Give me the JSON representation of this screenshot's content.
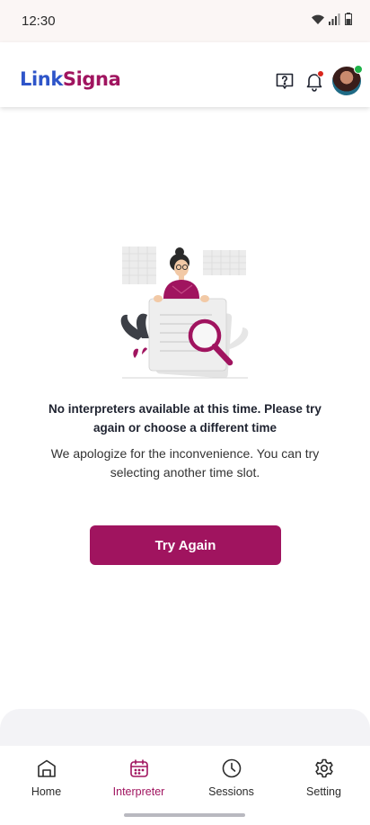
{
  "status_bar": {
    "time": "12:30"
  },
  "header": {
    "logo_part1": "Link",
    "logo_part2": "Signa",
    "icons": [
      "help-icon",
      "bell-icon",
      "avatar"
    ],
    "has_new_notification": true,
    "user_online": true
  },
  "empty_state": {
    "title": "No interpreters available at this time. Please try again or choose a different time",
    "subtitle": "We apologize for the inconvenience. You can try selecting another time slot.",
    "button_label": "Try Again"
  },
  "bottom_nav": {
    "items": [
      {
        "label": "Home",
        "icon": "home-icon",
        "active": false
      },
      {
        "label": "Interpreter",
        "icon": "calendar-icon",
        "active": true
      },
      {
        "label": "Sessions",
        "icon": "clock-icon",
        "active": false
      },
      {
        "label": "Setting",
        "icon": "gear-icon",
        "active": false
      }
    ]
  },
  "colors": {
    "brand_primary": "#a0145f",
    "brand_blue": "#2e55c9",
    "notification": "#d9261c",
    "online": "#1fb34a"
  }
}
